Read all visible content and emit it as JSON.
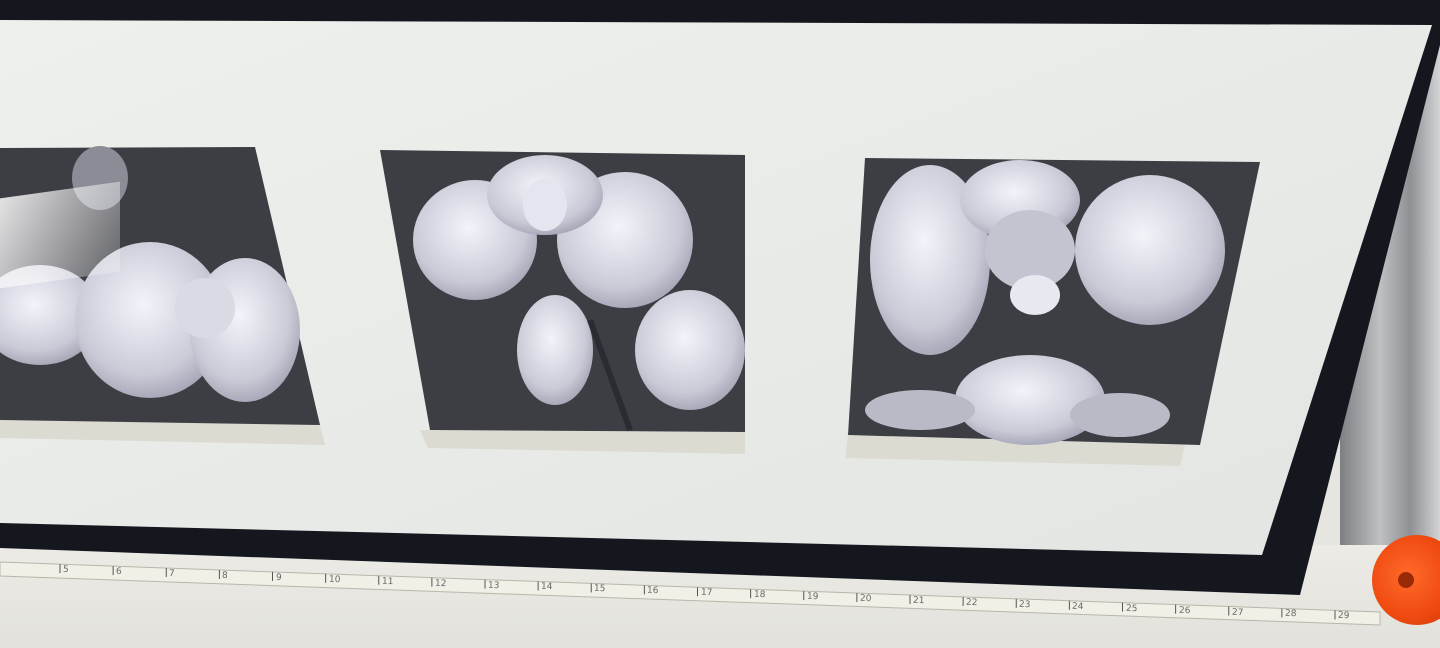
{
  "scene": {
    "subject": "Framed triptych of three orchid photographs above a measuring tape",
    "frame_color": "#15171f",
    "mat_color": "#e9ece9",
    "photo_tone": "#3d3e44",
    "tape_reel_color": "#f04a10"
  },
  "photos": [
    {
      "name": "left-orchid-photo"
    },
    {
      "name": "center-orchid-photo"
    },
    {
      "name": "right-orchid-photo"
    }
  ],
  "measuring_tape": {
    "tick_labels": [
      "5",
      "6",
      "7",
      "8",
      "9",
      "10",
      "11",
      "12",
      "13",
      "14",
      "15",
      "16",
      "17",
      "18",
      "19",
      "20",
      "21",
      "22",
      "23",
      "24",
      "25",
      "26",
      "27",
      "28",
      "29"
    ]
  }
}
